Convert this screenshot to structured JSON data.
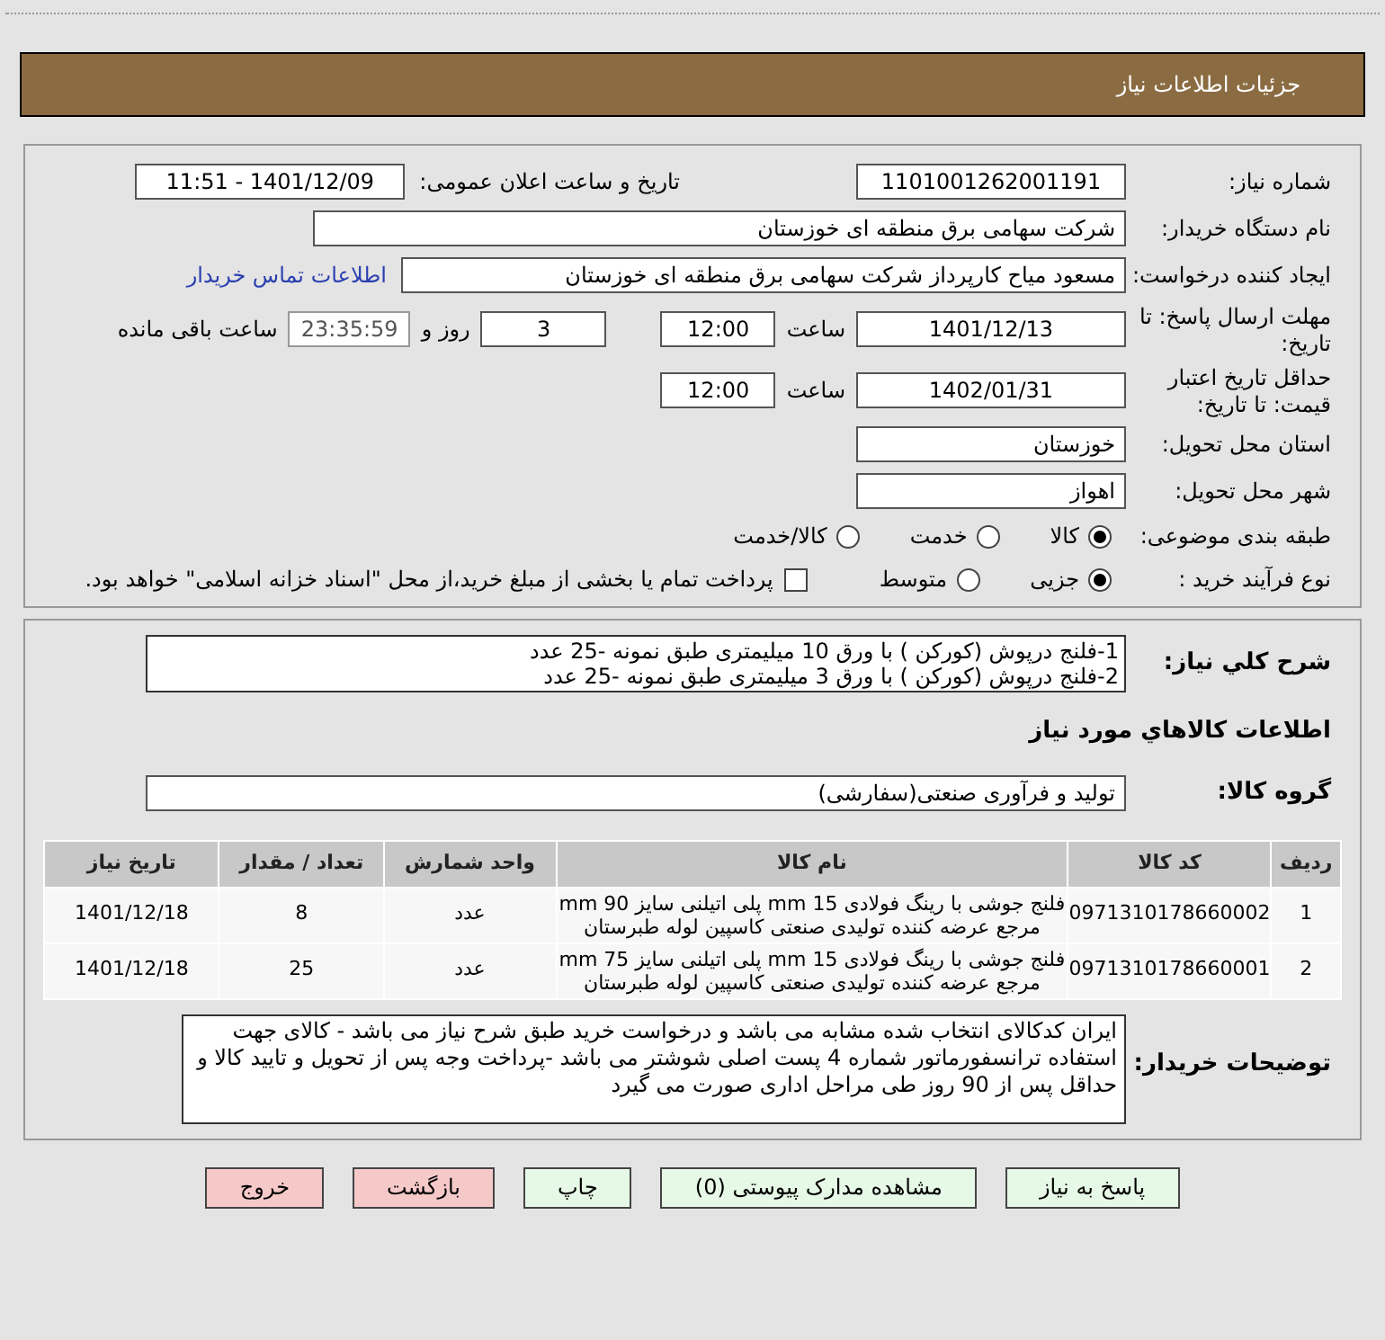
{
  "page_title": "جزئیات اطلاعات نیاز",
  "need_number": {
    "label": "شماره نیاز:",
    "value": "1101001262001191"
  },
  "announce": {
    "label": "تاریخ و ساعت اعلان عمومی:",
    "value": "1401/12/09 - 11:51"
  },
  "buyer_org": {
    "label": "نام دستگاه خریدار:",
    "value": "شرکت سهامی برق منطقه ای خوزستان"
  },
  "requester": {
    "label": "ایجاد کننده درخواست:",
    "value": "مسعود میاح کارپرداز شرکت سهامی برق منطقه ای خوزستان",
    "link": "اطلاعات تماس خریدار"
  },
  "response_deadline": {
    "label": "مهلت ارسال پاسخ: تا تاریخ:",
    "date": "1401/12/13",
    "time_label": "ساعت",
    "time": "12:00",
    "days": "3",
    "days_label": "روز و",
    "remaining": "23:35:59",
    "remaining_label": "ساعت باقی مانده"
  },
  "price_validity": {
    "label": "حداقل تاریخ اعتبار قیمت: تا تاریخ:",
    "date": "1402/01/31",
    "time_label": "ساعت",
    "time": "12:00"
  },
  "province": {
    "label": "استان محل تحویل:",
    "value": "خوزستان"
  },
  "city": {
    "label": "شهر محل تحویل:",
    "value": "اهواز"
  },
  "category": {
    "label": "طبقه بندی موضوعی:",
    "options": [
      {
        "label": "کالا",
        "selected": true
      },
      {
        "label": "خدمت",
        "selected": false
      },
      {
        "label": "کالا/خدمت",
        "selected": false
      }
    ]
  },
  "purchase_type": {
    "label": "نوع فرآیند خرید :",
    "options": [
      {
        "label": "جزیی",
        "selected": true
      },
      {
        "label": "متوسط",
        "selected": false
      }
    ],
    "treasury": {
      "label": "پرداخت تمام یا بخشی از مبلغ خرید،از محل \"اسناد خزانه اسلامی\" خواهد بود.",
      "checked": false
    }
  },
  "description": {
    "label": "شرح کلي نياز:",
    "lines": [
      "1-فلنج درپوش (کورکن ) با ورق 10 میلیمتری طبق نمونه -25 عدد",
      "2-فلنج درپوش (کورکن ) با ورق 3 میلیمتری طبق نمونه -25 عدد"
    ]
  },
  "goods_heading": "اطلاعات كالاهاي مورد نياز",
  "goods_group": {
    "label": "گروه کالا:",
    "value": "تولید و فرآوری صنعتی(سفارشی)"
  },
  "table": {
    "columns": [
      "ردیف",
      "کد کالا",
      "نام کالا",
      "واحد شمارش",
      "تعداد / مقدار",
      "تاریخ نیاز"
    ],
    "rows": [
      {
        "row": "1",
        "code": "0971310178660002",
        "name": [
          "فلنج جوشی با رینگ فولادی 15 mm پلی اتیلنی سایز 90 mm",
          "مرجع عرضه کننده تولیدی صنعتی کاسپین لوله طبرستان"
        ],
        "unit": "عدد",
        "qty": "8",
        "date": "1401/12/18"
      },
      {
        "row": "2",
        "code": "0971310178660001",
        "name": [
          "فلنج جوشی با رینگ فولادی 15 mm پلی اتیلنی سایز 75 mm",
          "مرجع عرضه کننده تولیدی صنعتی کاسپین لوله طبرستان"
        ],
        "unit": "عدد",
        "qty": "25",
        "date": "1401/12/18"
      }
    ]
  },
  "buyer_notes": {
    "label": "توضیحات خریدار:",
    "text": "ایران کدکالای انتخاب شده مشابه می باشد و درخواست خرید طبق شرح نیاز می باشد - کالای جهت استفاده ترانسفورماتور شماره 4 پست اصلی شوشتر می باشد  -پرداخت وجه پس از تحویل و تایید کالا و حداقل پس از 90 روز طی مراحل اداری صورت می گیرد"
  },
  "buttons": [
    {
      "label": "پاسخ به نیاز",
      "kind": "primary"
    },
    {
      "label": "مشاهده مدارک پیوستی (0)",
      "kind": "primary"
    },
    {
      "label": "چاپ",
      "kind": "primary"
    },
    {
      "label": "بازگشت",
      "kind": "danger"
    },
    {
      "label": "خروج",
      "kind": "danger"
    }
  ]
}
